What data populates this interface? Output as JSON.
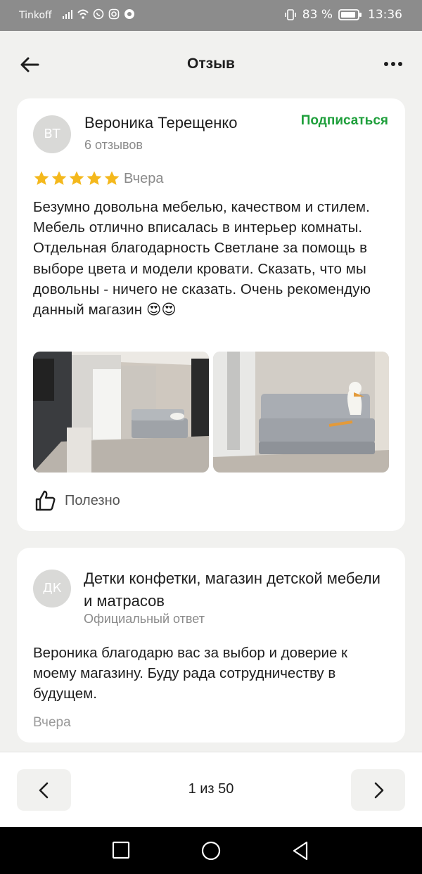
{
  "status_bar": {
    "carrier": "Tinkoff",
    "battery": "83 %",
    "time": "13:36"
  },
  "header": {
    "title": "Отзыв"
  },
  "review": {
    "avatar_initials": "ВТ",
    "author": "Вероника Терещенко",
    "reviews_count": "6 отзывов",
    "subscribe_label": "Подписаться",
    "rating": 5,
    "date": "Вчера",
    "text": "Безумно довольна мебелью, качеством и стилем. Мебель отлично вписалась в интерьер комнаты. Отдельная благодарность Светлане за помощь в выборе цвета и модели кровати. Сказать, что мы довольны - ничего не сказать. Очень рекомендую данный магазин 😍😍",
    "useful_label": "Полезно"
  },
  "answer": {
    "avatar_initials": "ДК",
    "shop_name": "Детки конфетки, магазин детской мебели и  матрасов",
    "label": "Официальный ответ",
    "text": "Вероника благодарю вас за выбор и доверие к моему магазину. Буду рада сотрудничеству в будущем.",
    "date": "Вчера"
  },
  "pagination": {
    "text": "1 из 50"
  },
  "colors": {
    "accent_green": "#1e9f3b",
    "star": "#f4b81c",
    "background": "#f1f1ef"
  }
}
